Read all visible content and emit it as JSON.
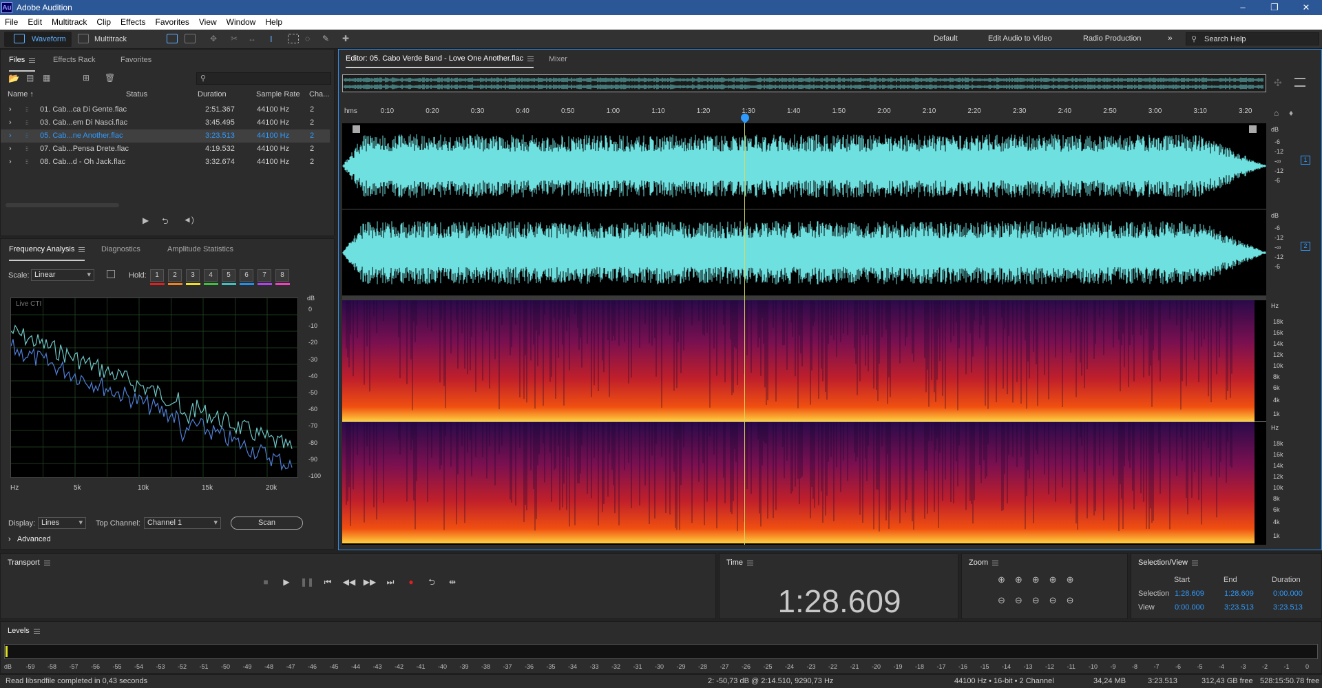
{
  "window": {
    "title": "Adobe Audition",
    "logo": "Au"
  },
  "menu": [
    "File",
    "Edit",
    "Multitrack",
    "Clip",
    "Effects",
    "Favorites",
    "View",
    "Window",
    "Help"
  ],
  "toolbar": {
    "waveform": "Waveform",
    "multitrack": "Multitrack",
    "workspaces": [
      "Default",
      "Edit Audio to Video",
      "Radio Production"
    ],
    "search_placeholder": "Search Help"
  },
  "files_panel": {
    "tabs": [
      "Files",
      "Effects Rack",
      "Favorites"
    ],
    "columns": [
      "Name",
      "Status",
      "Duration",
      "Sample Rate",
      "Cha..."
    ],
    "rows": [
      {
        "name": "01. Cab...ca Di Gente.flac",
        "duration": "2:51.367",
        "rate": "44100 Hz",
        "ch": "2",
        "selected": false
      },
      {
        "name": "03. Cab...em Di Nasci.flac",
        "duration": "3:45.495",
        "rate": "44100 Hz",
        "ch": "2",
        "selected": false
      },
      {
        "name": "05. Cab...ne Another.flac",
        "duration": "3:23.513",
        "rate": "44100 Hz",
        "ch": "2",
        "selected": true
      },
      {
        "name": "07. Cab...Pensa Drete.flac",
        "duration": "4:19.532",
        "rate": "44100 Hz",
        "ch": "2",
        "selected": false
      },
      {
        "name": "08. Cab...d - Oh Jack.flac",
        "duration": "3:32.674",
        "rate": "44100 Hz",
        "ch": "2",
        "selected": false
      }
    ]
  },
  "freq_panel": {
    "tabs": [
      "Frequency Analysis",
      "Diagnostics",
      "Amplitude Statistics"
    ],
    "scale_label": "Scale:",
    "scale_value": "Linear",
    "hold_label": "Hold:",
    "hold": [
      "1",
      "2",
      "3",
      "4",
      "5",
      "6",
      "7",
      "8"
    ],
    "hold_colors": [
      "#e02020",
      "#f08020",
      "#f0e020",
      "#40c040",
      "#40c0c0",
      "#2090f0",
      "#b040f0",
      "#f040c0"
    ],
    "live": "Live CTI",
    "db_unit": "dB",
    "db_ticks": [
      "0",
      "-10",
      "-20",
      "-30",
      "-40",
      "-50",
      "-60",
      "-70",
      "-80",
      "-90",
      "-100"
    ],
    "hz_ticks": [
      "Hz",
      "5k",
      "10k",
      "15k",
      "20k"
    ],
    "display_label": "Display:",
    "display_value": "Lines",
    "channel_label": "Top Channel:",
    "channel_value": "Channel 1",
    "scan": "Scan",
    "advanced": "Advanced"
  },
  "editor": {
    "tab": "Editor: 05. Cabo Verde Band - Love One Another.flac",
    "mixer": "Mixer",
    "ruler": [
      "hms",
      "0:10",
      "0:20",
      "0:30",
      "0:40",
      "0:50",
      "1:00",
      "1:10",
      "1:20",
      "1:30",
      "1:40",
      "1:50",
      "2:00",
      "2:10",
      "2:20",
      "2:30",
      "2:40",
      "2:50",
      "3:00",
      "3:10",
      "3:20"
    ],
    "db_ticks": [
      "dB",
      "-6",
      "-12",
      "-∞",
      "-12",
      "-6"
    ],
    "hz_ticks": [
      "Hz",
      "18k",
      "16k",
      "14k",
      "12k",
      "10k",
      "8k",
      "6k",
      "4k",
      "1k"
    ],
    "channels": [
      "1",
      "2"
    ]
  },
  "transport": {
    "title": "Transport"
  },
  "time": {
    "title": "Time",
    "value": "1:28.609"
  },
  "zoom": {
    "title": "Zoom"
  },
  "selview": {
    "title": "Selection/View",
    "col_start": "Start",
    "col_end": "End",
    "col_dur": "Duration",
    "sel_label": "Selection",
    "sel_start": "1:28.609",
    "sel_end": "1:28.609",
    "sel_dur": "0:00.000",
    "view_label": "View",
    "view_start": "0:00.000",
    "view_end": "3:23.513",
    "view_dur": "3:23.513"
  },
  "levels": {
    "title": "Levels",
    "ticks": [
      "dB",
      "-59",
      "-58",
      "-57",
      "-56",
      "-55",
      "-54",
      "-53",
      "-52",
      "-51",
      "-50",
      "-49",
      "-48",
      "-47",
      "-46",
      "-45",
      "-44",
      "-43",
      "-42",
      "-41",
      "-40",
      "-39",
      "-38",
      "-37",
      "-36",
      "-35",
      "-34",
      "-33",
      "-32",
      "-31",
      "-30",
      "-29",
      "-28",
      "-27",
      "-26",
      "-25",
      "-24",
      "-23",
      "-22",
      "-21",
      "-20",
      "-19",
      "-18",
      "-17",
      "-16",
      "-15",
      "-14",
      "-13",
      "-12",
      "-11",
      "-10",
      "-9",
      "-8",
      "-7",
      "-6",
      "-5",
      "-4",
      "-3",
      "-2",
      "-1",
      "0"
    ]
  },
  "status": {
    "left": "Read libsndfile completed in 0,43 seconds",
    "cursor": "2: -50,73 dB @ 2:14.510, 9290,73 Hz",
    "format": "44100 Hz • 16-bit • 2 Channel",
    "size": "34,24 MB",
    "duration": "3:23.513",
    "free": "312,43 GB free",
    "free_time": "528:15:50.78 free"
  }
}
